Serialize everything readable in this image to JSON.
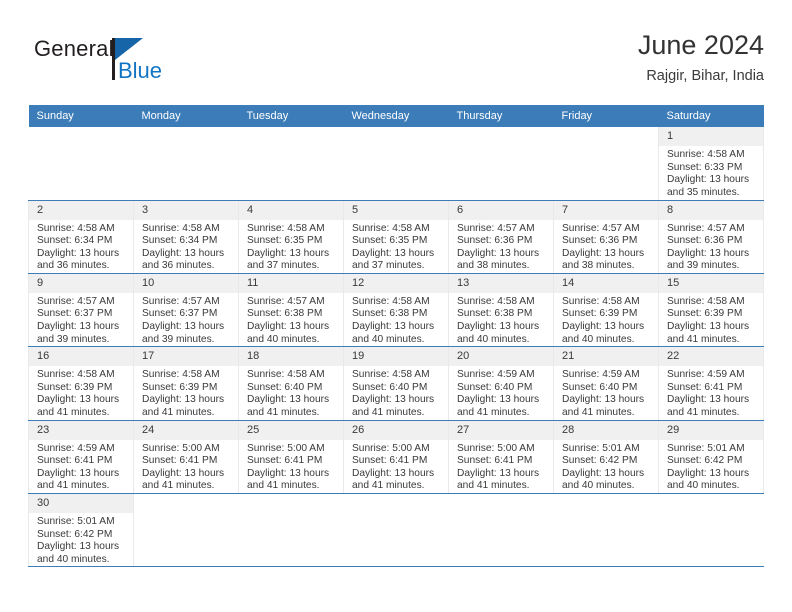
{
  "logo": {
    "word_one": "General",
    "word_two": "Blue",
    "flag_color": "#1565a8",
    "blue_text_color": "#1275c4"
  },
  "header": {
    "title": "June 2024",
    "subtitle": "Rajgir, Bihar, India"
  },
  "theme": {
    "header_blue": "#3c7cb8",
    "daynum_gray": "#f0f0f0",
    "text_color": "#3a3a3a"
  },
  "calendar": {
    "weekday_headers": [
      "Sunday",
      "Monday",
      "Tuesday",
      "Wednesday",
      "Thursday",
      "Friday",
      "Saturday"
    ],
    "weeks": [
      [
        {
          "day": "",
          "lines": []
        },
        {
          "day": "",
          "lines": []
        },
        {
          "day": "",
          "lines": []
        },
        {
          "day": "",
          "lines": []
        },
        {
          "day": "",
          "lines": []
        },
        {
          "day": "",
          "lines": []
        },
        {
          "day": "1",
          "lines": [
            "Sunrise: 4:58 AM",
            "Sunset: 6:33 PM",
            "Daylight: 13 hours",
            "and 35 minutes."
          ]
        }
      ],
      [
        {
          "day": "2",
          "lines": [
            "Sunrise: 4:58 AM",
            "Sunset: 6:34 PM",
            "Daylight: 13 hours",
            "and 36 minutes."
          ]
        },
        {
          "day": "3",
          "lines": [
            "Sunrise: 4:58 AM",
            "Sunset: 6:34 PM",
            "Daylight: 13 hours",
            "and 36 minutes."
          ]
        },
        {
          "day": "4",
          "lines": [
            "Sunrise: 4:58 AM",
            "Sunset: 6:35 PM",
            "Daylight: 13 hours",
            "and 37 minutes."
          ]
        },
        {
          "day": "5",
          "lines": [
            "Sunrise: 4:58 AM",
            "Sunset: 6:35 PM",
            "Daylight: 13 hours",
            "and 37 minutes."
          ]
        },
        {
          "day": "6",
          "lines": [
            "Sunrise: 4:57 AM",
            "Sunset: 6:36 PM",
            "Daylight: 13 hours",
            "and 38 minutes."
          ]
        },
        {
          "day": "7",
          "lines": [
            "Sunrise: 4:57 AM",
            "Sunset: 6:36 PM",
            "Daylight: 13 hours",
            "and 38 minutes."
          ]
        },
        {
          "day": "8",
          "lines": [
            "Sunrise: 4:57 AM",
            "Sunset: 6:36 PM",
            "Daylight: 13 hours",
            "and 39 minutes."
          ]
        }
      ],
      [
        {
          "day": "9",
          "lines": [
            "Sunrise: 4:57 AM",
            "Sunset: 6:37 PM",
            "Daylight: 13 hours",
            "and 39 minutes."
          ]
        },
        {
          "day": "10",
          "lines": [
            "Sunrise: 4:57 AM",
            "Sunset: 6:37 PM",
            "Daylight: 13 hours",
            "and 39 minutes."
          ]
        },
        {
          "day": "11",
          "lines": [
            "Sunrise: 4:57 AM",
            "Sunset: 6:38 PM",
            "Daylight: 13 hours",
            "and 40 minutes."
          ]
        },
        {
          "day": "12",
          "lines": [
            "Sunrise: 4:58 AM",
            "Sunset: 6:38 PM",
            "Daylight: 13 hours",
            "and 40 minutes."
          ]
        },
        {
          "day": "13",
          "lines": [
            "Sunrise: 4:58 AM",
            "Sunset: 6:38 PM",
            "Daylight: 13 hours",
            "and 40 minutes."
          ]
        },
        {
          "day": "14",
          "lines": [
            "Sunrise: 4:58 AM",
            "Sunset: 6:39 PM",
            "Daylight: 13 hours",
            "and 40 minutes."
          ]
        },
        {
          "day": "15",
          "lines": [
            "Sunrise: 4:58 AM",
            "Sunset: 6:39 PM",
            "Daylight: 13 hours",
            "and 41 minutes."
          ]
        }
      ],
      [
        {
          "day": "16",
          "lines": [
            "Sunrise: 4:58 AM",
            "Sunset: 6:39 PM",
            "Daylight: 13 hours",
            "and 41 minutes."
          ]
        },
        {
          "day": "17",
          "lines": [
            "Sunrise: 4:58 AM",
            "Sunset: 6:39 PM",
            "Daylight: 13 hours",
            "and 41 minutes."
          ]
        },
        {
          "day": "18",
          "lines": [
            "Sunrise: 4:58 AM",
            "Sunset: 6:40 PM",
            "Daylight: 13 hours",
            "and 41 minutes."
          ]
        },
        {
          "day": "19",
          "lines": [
            "Sunrise: 4:58 AM",
            "Sunset: 6:40 PM",
            "Daylight: 13 hours",
            "and 41 minutes."
          ]
        },
        {
          "day": "20",
          "lines": [
            "Sunrise: 4:59 AM",
            "Sunset: 6:40 PM",
            "Daylight: 13 hours",
            "and 41 minutes."
          ]
        },
        {
          "day": "21",
          "lines": [
            "Sunrise: 4:59 AM",
            "Sunset: 6:40 PM",
            "Daylight: 13 hours",
            "and 41 minutes."
          ]
        },
        {
          "day": "22",
          "lines": [
            "Sunrise: 4:59 AM",
            "Sunset: 6:41 PM",
            "Daylight: 13 hours",
            "and 41 minutes."
          ]
        }
      ],
      [
        {
          "day": "23",
          "lines": [
            "Sunrise: 4:59 AM",
            "Sunset: 6:41 PM",
            "Daylight: 13 hours",
            "and 41 minutes."
          ]
        },
        {
          "day": "24",
          "lines": [
            "Sunrise: 5:00 AM",
            "Sunset: 6:41 PM",
            "Daylight: 13 hours",
            "and 41 minutes."
          ]
        },
        {
          "day": "25",
          "lines": [
            "Sunrise: 5:00 AM",
            "Sunset: 6:41 PM",
            "Daylight: 13 hours",
            "and 41 minutes."
          ]
        },
        {
          "day": "26",
          "lines": [
            "Sunrise: 5:00 AM",
            "Sunset: 6:41 PM",
            "Daylight: 13 hours",
            "and 41 minutes."
          ]
        },
        {
          "day": "27",
          "lines": [
            "Sunrise: 5:00 AM",
            "Sunset: 6:41 PM",
            "Daylight: 13 hours",
            "and 41 minutes."
          ]
        },
        {
          "day": "28",
          "lines": [
            "Sunrise: 5:01 AM",
            "Sunset: 6:42 PM",
            "Daylight: 13 hours",
            "and 40 minutes."
          ]
        },
        {
          "day": "29",
          "lines": [
            "Sunrise: 5:01 AM",
            "Sunset: 6:42 PM",
            "Daylight: 13 hours",
            "and 40 minutes."
          ]
        }
      ],
      [
        {
          "day": "30",
          "lines": [
            "Sunrise: 5:01 AM",
            "Sunset: 6:42 PM",
            "Daylight: 13 hours",
            "and 40 minutes."
          ]
        },
        {
          "day": "",
          "lines": []
        },
        {
          "day": "",
          "lines": []
        },
        {
          "day": "",
          "lines": []
        },
        {
          "day": "",
          "lines": []
        },
        {
          "day": "",
          "lines": []
        },
        {
          "day": "",
          "lines": []
        }
      ]
    ]
  }
}
